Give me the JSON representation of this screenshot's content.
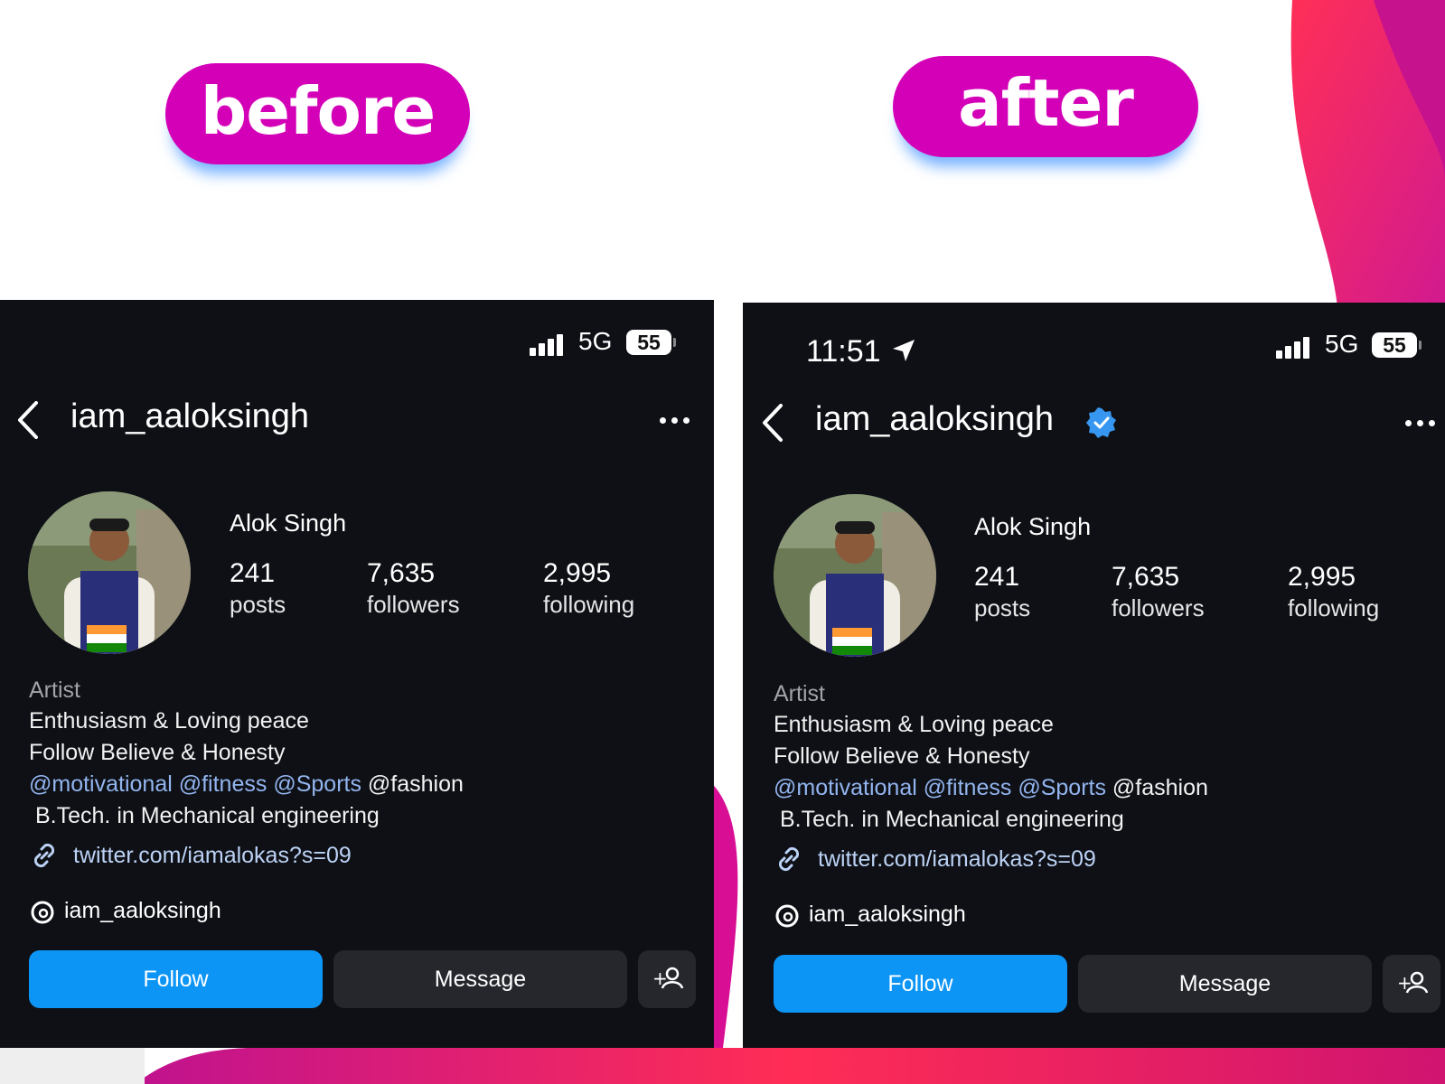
{
  "labels": {
    "before": "before",
    "after": "after"
  },
  "profile": {
    "username": "iam_aaloksingh",
    "full_name": "Alok Singh",
    "stats": [
      {
        "value": "241",
        "label": "posts"
      },
      {
        "value": "7,635",
        "label": "followers"
      },
      {
        "value": "2,995",
        "label": "following"
      }
    ],
    "category": "Artist",
    "bio_line1": "Enthusiasm & Loving peace",
    "bio_line2": "Follow Believe & Honesty",
    "mentions": [
      "@motivational",
      "@fitness",
      "@Sports"
    ],
    "mention_plain": "@fashion",
    "bio_line4": "B.Tech. in Mechanical engineering",
    "link": "twitter.com/iamalokas?s=09",
    "threads_handle": "iam_aaloksingh"
  },
  "status_bar": {
    "time": "11:51",
    "network": "5G",
    "battery": "55"
  },
  "buttons": {
    "follow": "Follow",
    "message": "Message"
  },
  "after_verified": true,
  "colors": {
    "accent_pink": "#d400b8",
    "follow_blue": "#0d95f6",
    "panel_bg": "#0e1016",
    "verified_blue": "#3797f0"
  }
}
